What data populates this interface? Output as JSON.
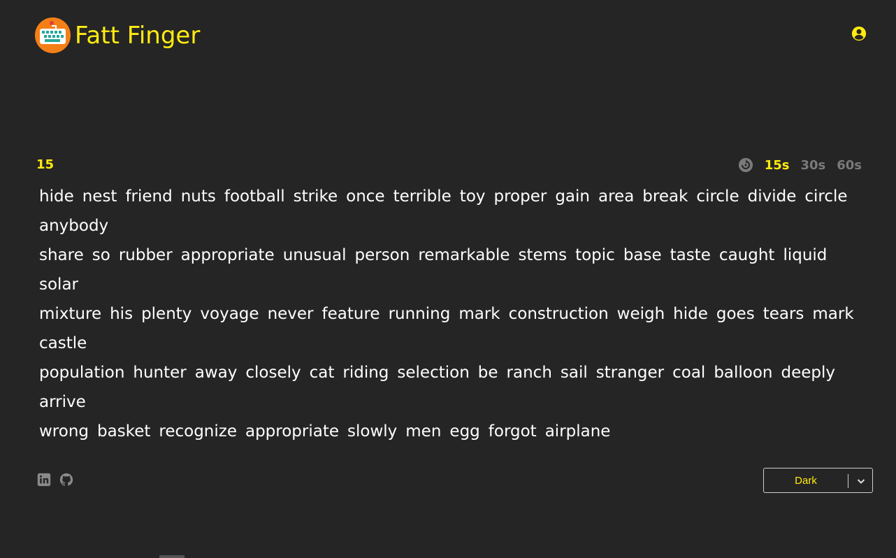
{
  "header": {
    "title": "Fatt Finger",
    "logo_icon": "keyboard-icon",
    "account_icon": "account-circle-icon"
  },
  "colors": {
    "background": "#252525",
    "accent": "#ffeb10",
    "muted": "#7a7a7a",
    "text": "#ffffff",
    "logo_bg": "#f57f17"
  },
  "test": {
    "timer": "15",
    "restart_icon": "restart-icon",
    "time_options": [
      {
        "label": "15s",
        "active": true
      },
      {
        "label": "30s",
        "active": false
      },
      {
        "label": "60s",
        "active": false
      }
    ],
    "lines": [
      [
        "hide",
        "nest",
        "friend",
        "nuts",
        "football",
        "strike",
        "once",
        "terrible",
        "toy",
        "proper",
        "gain",
        "area",
        "break",
        "circle",
        "divide",
        "circle",
        "anybody"
      ],
      [
        "share",
        "so",
        "rubber",
        "appropriate",
        "unusual",
        "person",
        "remarkable",
        "stems",
        "topic",
        "base",
        "taste",
        "caught",
        "liquid",
        "solar"
      ],
      [
        "mixture",
        "his",
        "plenty",
        "voyage",
        "never",
        "feature",
        "running",
        "mark",
        "construction",
        "weigh",
        "hide",
        "goes",
        "tears",
        "mark",
        "castle"
      ],
      [
        "population",
        "hunter",
        "away",
        "closely",
        "cat",
        "riding",
        "selection",
        "be",
        "ranch",
        "sail",
        "stranger",
        "coal",
        "balloon",
        "deeply",
        "arrive"
      ],
      [
        "wrong",
        "basket",
        "recognize",
        "appropriate",
        "slowly",
        "men",
        "egg",
        "forgot",
        "airplane"
      ]
    ]
  },
  "footer": {
    "icons": [
      "linkedin-icon",
      "github-icon"
    ],
    "theme_select": {
      "value": "Dark",
      "icon": "chevron-down-icon"
    }
  }
}
